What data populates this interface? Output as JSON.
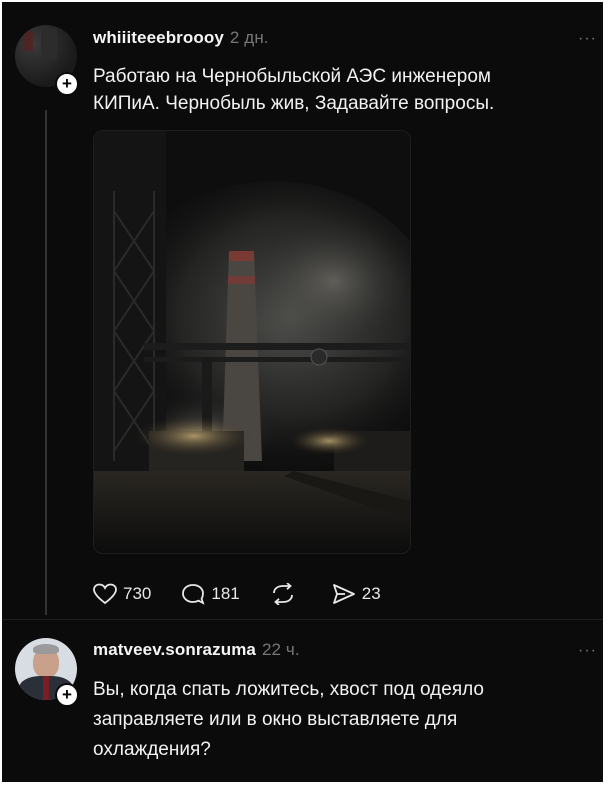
{
  "post": {
    "username": "whiiiteeebroooy",
    "time": "2 дн.",
    "text_line1": "Работаю на Чернобыльской АЭС инженером",
    "text_line2": "КИПиА. Чернобыль жив, Задавайте вопросы.",
    "likes": "730",
    "comments": "181",
    "shares": "23",
    "more": "···"
  },
  "reply": {
    "username": "matveev.sonrazuma",
    "time": "22 ч.",
    "text_line1": "Вы, когда спать ложитесь, хвост под одеяло",
    "text_line2": "заправляете или в окно выставляете для",
    "text_line3": "охлаждения?",
    "more": "···"
  },
  "icons": {
    "like": "heart-icon",
    "comment": "comment-bubble-icon",
    "repost": "repost-icon",
    "share": "send-icon",
    "follow": "plus-icon"
  },
  "colors": {
    "background": "#0b0b0b",
    "text": "#f2f2f2",
    "muted": "#777777"
  }
}
